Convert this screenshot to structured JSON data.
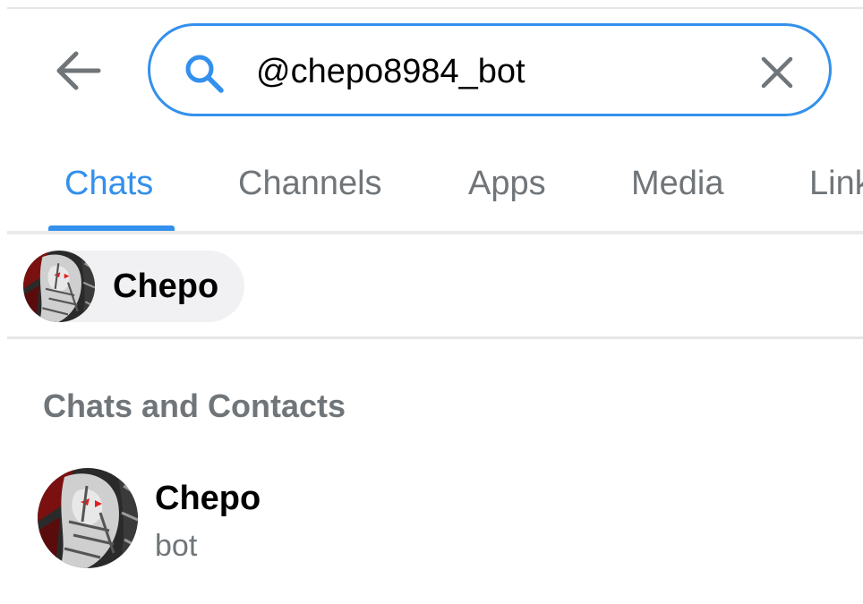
{
  "search": {
    "value": "@chepo8984_bot",
    "icons": {
      "back": "arrow-left-icon",
      "search": "search-icon",
      "clear": "close-icon"
    }
  },
  "tabs": [
    {
      "label": "Chats",
      "active": true
    },
    {
      "label": "Channels",
      "active": false
    },
    {
      "label": "Apps",
      "active": false
    },
    {
      "label": "Media",
      "active": false
    },
    {
      "label": "Links",
      "active": false
    }
  ],
  "recent_peers": [
    {
      "name": "Chepo"
    }
  ],
  "section": {
    "title": "Chats and Contacts"
  },
  "results": [
    {
      "name": "Chepo",
      "status": "bot"
    }
  ],
  "colors": {
    "accent": "#3390ec",
    "secondary_text": "#707579",
    "chip_bg": "#f1f1f3"
  }
}
